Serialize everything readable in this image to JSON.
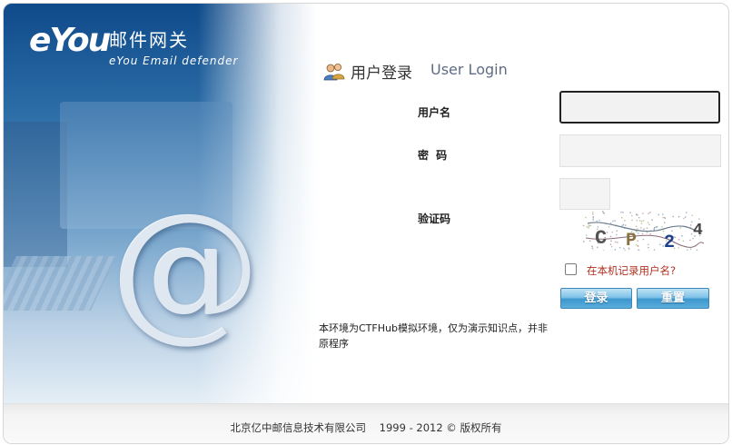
{
  "brand": {
    "logo_mark": "eYou",
    "product_cn": "邮件网关",
    "product_en": "eYou Email defender"
  },
  "login": {
    "title_cn": "用户登录",
    "title_en": "User Login",
    "username_label": "用户名",
    "password_label": "密 码",
    "captcha_label": "验证码",
    "username_value": "",
    "password_value": "",
    "captcha_value": "",
    "captcha_chars": [
      "C",
      "P",
      "2",
      "4"
    ],
    "remember_label": "在本机记录用户名?",
    "remember_checked": false,
    "login_button": "登录",
    "reset_button": "重置"
  },
  "notice": "本环境为CTFHub模拟环境，仅为演示知识点，并非原程序",
  "footer": {
    "copyright": "北京亿中邮信息技术有限公司    1999 - 2012 © 版权所有"
  },
  "colors": {
    "button_blue": "#3c97cd",
    "remember_text": "#b03020",
    "hero_blue": "#0f4a8a"
  },
  "icons": [
    "users-icon",
    "at-symbol-graphic"
  ]
}
